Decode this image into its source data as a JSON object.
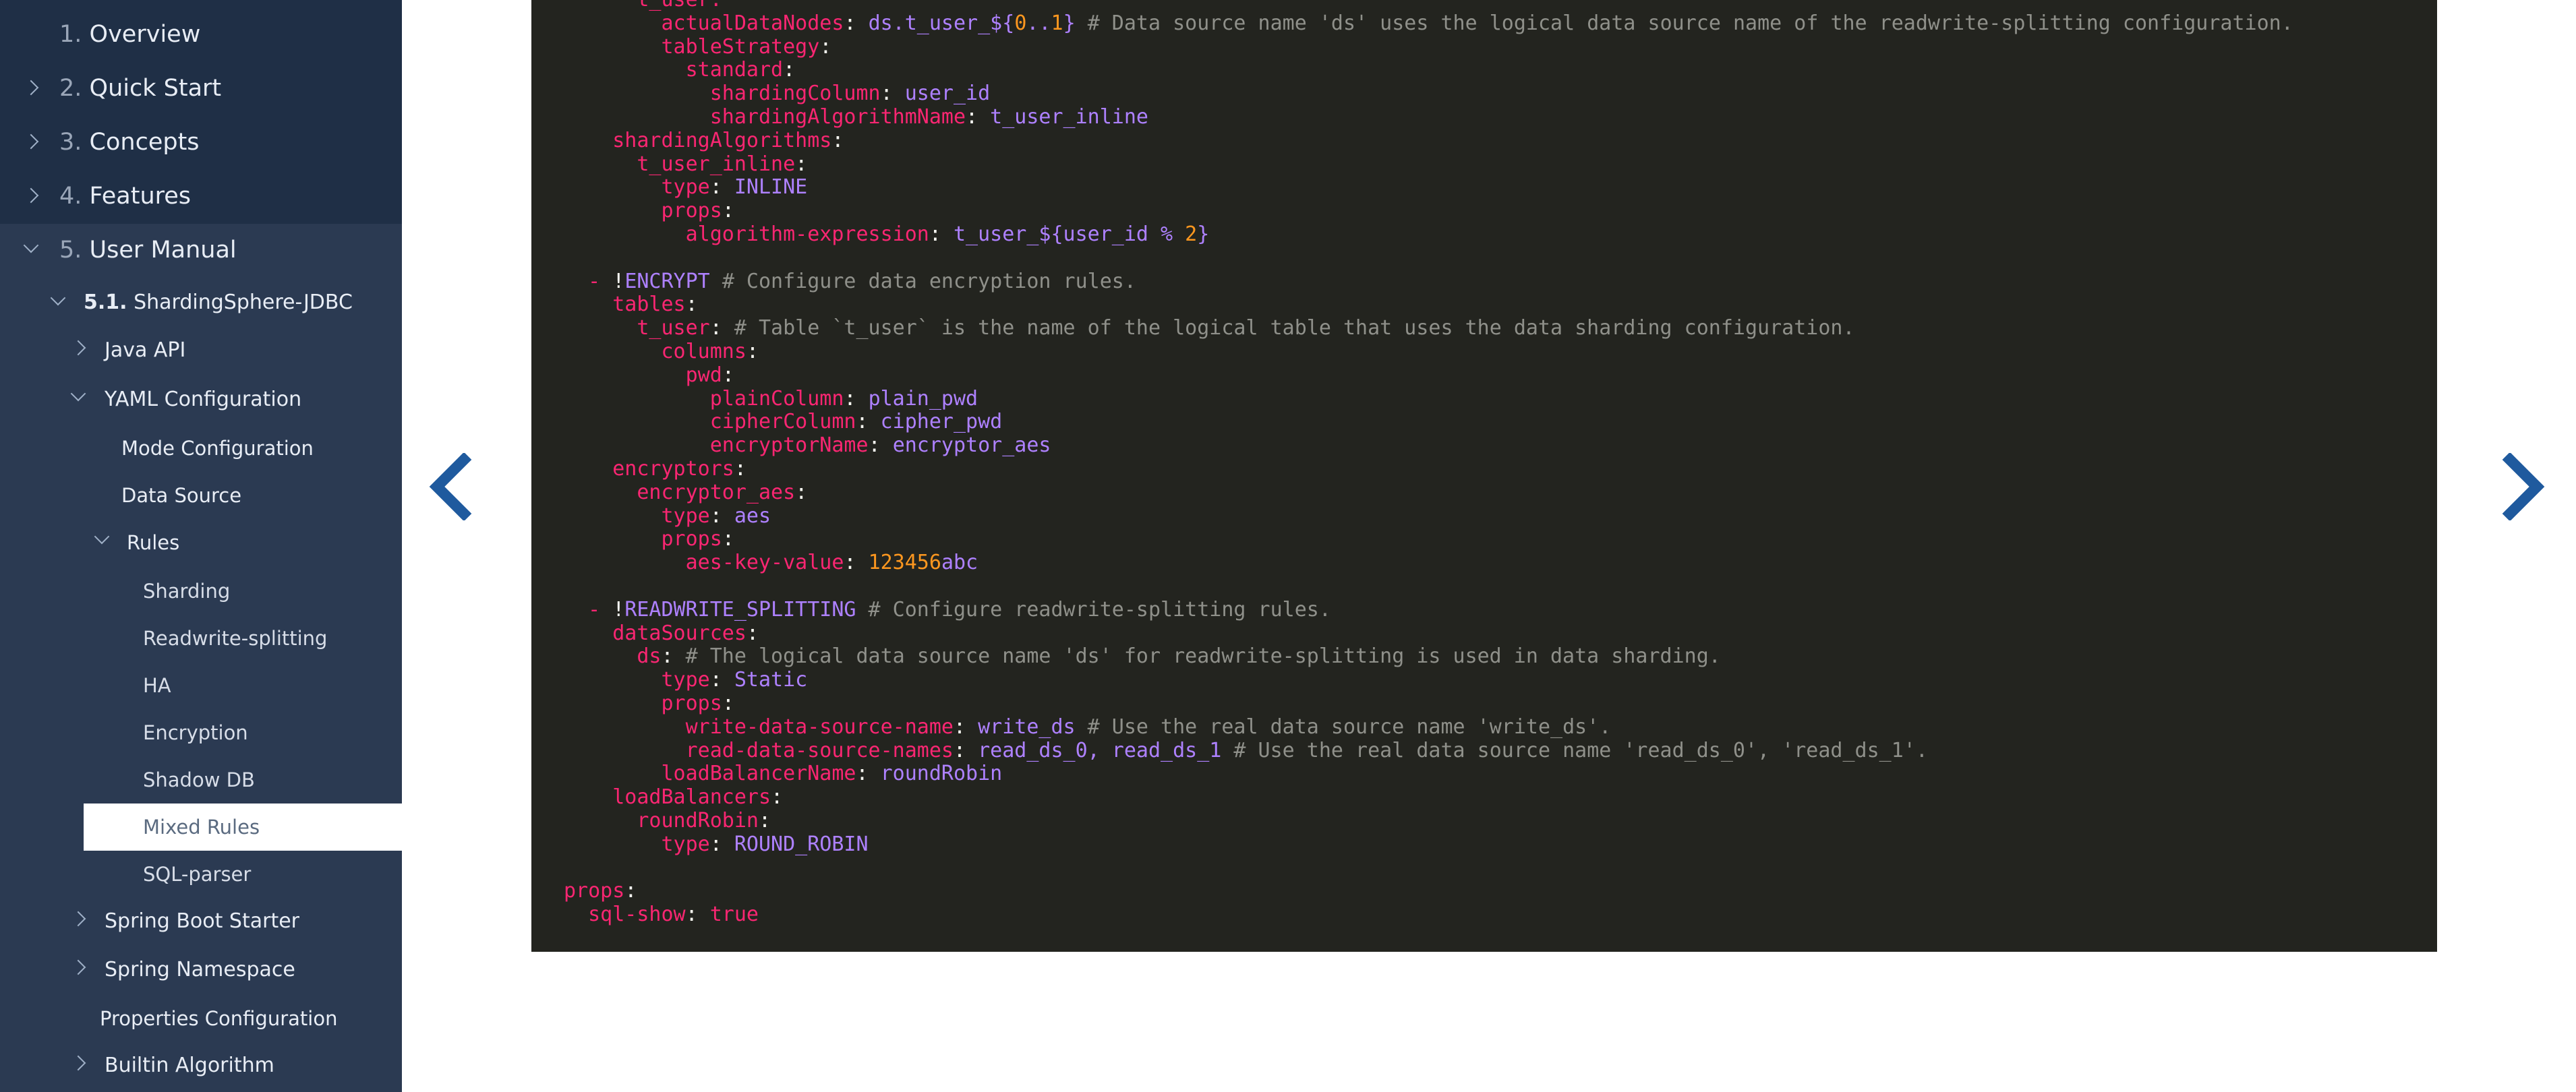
{
  "sidebar": {
    "items": [
      {
        "num": "1.",
        "label": "Overview"
      },
      {
        "num": "2.",
        "label": "Quick Start"
      },
      {
        "num": "3.",
        "label": "Concepts"
      },
      {
        "num": "4.",
        "label": "Features"
      },
      {
        "num": "5.",
        "label": "User Manual"
      },
      {
        "num": "5.1.",
        "label": "ShardingSphere-JDBC"
      },
      {
        "label": "Java API"
      },
      {
        "label": "YAML Configuration"
      },
      {
        "label": "Mode Configuration"
      },
      {
        "label": "Data Source"
      },
      {
        "label": "Rules"
      },
      {
        "label": "Sharding"
      },
      {
        "label": "Readwrite-splitting"
      },
      {
        "label": "HA"
      },
      {
        "label": "Encryption"
      },
      {
        "label": "Shadow DB"
      },
      {
        "label": "Mixed Rules"
      },
      {
        "label": "SQL-parser"
      },
      {
        "label": "Spring Boot Starter"
      },
      {
        "label": "Spring Namespace"
      },
      {
        "label": "Properties Configuration"
      },
      {
        "label": "Builtin Algorithm"
      }
    ]
  },
  "code": {
    "l01": "t_user:",
    "l02_key": "actualDataNodes",
    "l02_val": "ds.t_user_${",
    "l02_n1": "0",
    "l02_dots": "..",
    "l02_n2": "1",
    "l02_end": "}",
    "l02_cmt": "# Data source name 'ds' uses the logical data source name of the readwrite-splitting configuration.",
    "l03": "tableStrategy",
    "l04": "standard",
    "l05_key": "shardingColumn",
    "l05_val": "user_id",
    "l06_key": "shardingAlgorithmName",
    "l06_val": "t_user_inline",
    "l07": "shardingAlgorithms",
    "l08": "t_user_inline",
    "l09_key": "type",
    "l09_val": "INLINE",
    "l10": "props",
    "l11_key": "algorithm-expression",
    "l11_val": "t_user_${user_id % ",
    "l11_n": "2",
    "l11_end": "}",
    "l13_dash": "- ",
    "l13_bang": "!",
    "l13_tag": "ENCRYPT",
    "l13_cmt": "# Configure data encryption rules.",
    "l14": "tables",
    "l15_key": "t_user",
    "l15_cmt": "# Table `t_user` is the name of the logical table that uses the data sharding configuration.",
    "l16": "columns",
    "l17": "pwd",
    "l18_key": "plainColumn",
    "l18_val": "plain_pwd",
    "l19_key": "cipherColumn",
    "l19_val": "cipher_pwd",
    "l20_key": "encryptorName",
    "l20_val": "encryptor_aes",
    "l21": "encryptors",
    "l22": "encryptor_aes",
    "l23_key": "type",
    "l23_val": "aes",
    "l24": "props",
    "l25_key": "aes-key-value",
    "l25_n": "123456",
    "l25_val": "abc",
    "l27_dash": "- ",
    "l27_bang": "!",
    "l27_tag": "READWRITE_SPLITTING",
    "l27_cmt": "# Configure readwrite-splitting rules.",
    "l28": "dataSources",
    "l29_key": "ds",
    "l29_cmt": "# The logical data source name 'ds' for readwrite-splitting is used in data sharding.",
    "l30_key": "type",
    "l30_val": "Static",
    "l31": "props",
    "l32_key": "write-data-source-name",
    "l32_val": "write_ds",
    "l32_cmt": "# Use the real data source name 'write_ds'.",
    "l33_key": "read-data-source-names",
    "l33_val": "read_ds_0, read_ds_1",
    "l33_cmt": "# Use the real data source name 'read_ds_0', 'read_ds_1'.",
    "l34_key": "loadBalancerName",
    "l34_val": "roundRobin",
    "l35": "loadBalancers",
    "l36": "roundRobin",
    "l37_key": "type",
    "l37_val": "ROUND_ROBIN",
    "l39": "props",
    "l40_key": "sql-show",
    "l40_val": "true"
  },
  "nav": {
    "prev_icon": "chevron-left-icon",
    "next_icon": "chevron-right-icon",
    "accent": "#1f5a9e"
  },
  "colors": {
    "sidebar_bg": "#2b3a52",
    "sidebar_top_bg": "#1f2f46",
    "code_bg": "#23241f",
    "key": "#f92672",
    "value": "#ae81ff",
    "number": "#fd971f",
    "comment": "#8f908a"
  }
}
